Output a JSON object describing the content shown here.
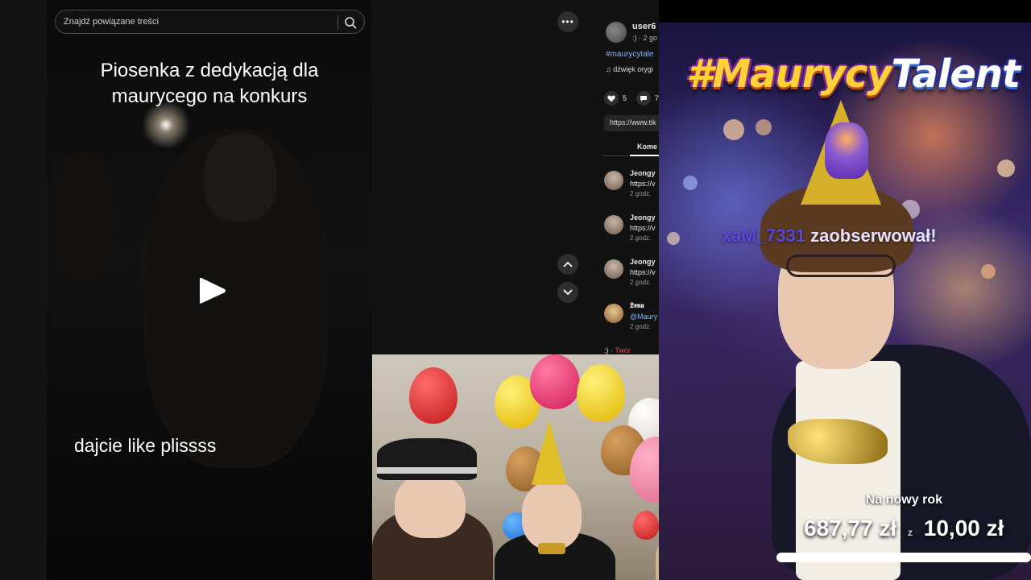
{
  "search": {
    "placeholder": "Znajdź powiązane treści"
  },
  "video": {
    "caption_top": "Piosenka z dedykacją dla maurycego na konkurs",
    "caption_bottom": "dajcie like plissss"
  },
  "more_button": {
    "label": "•••"
  },
  "info": {
    "username": "user6",
    "time": ":) · 2 go",
    "hashtag": "#maurycytale",
    "sound": "dźwięk orygi",
    "likes": "5",
    "comments_count": "7",
    "url": "https://www.tik",
    "tab": "Kome",
    "comments": [
      {
        "user": "Jeongy",
        "text": "https://v",
        "time": "2 godz."
      },
      {
        "user": "Jeongy",
        "text": "https://v",
        "time": "2 godz."
      },
      {
        "user": "Jeongy",
        "text": "https://v",
        "time": "2 godz."
      },
      {
        "user": "𝕷𝖊𝖓𝖆",
        "text": "@Maury",
        "time": "2 godz."
      }
    ],
    "last_row_prefix": ":) ·",
    "last_row_creator": "Twór"
  },
  "overlay": {
    "title_part1": "#Maurycy",
    "title_part2": "Talent",
    "follow_user": "xaM_7331",
    "follow_action": "zaobserwował!",
    "goal_label": "Na nowy rok",
    "goal_current": "687,77 zł",
    "goal_separator": "z",
    "goal_target": "10,00 zł",
    "goal_progress": 1.0
  },
  "colors": {
    "accent_link": "#7eb6ff",
    "creator_red": "#ff3b5c",
    "title_yellow": "#ffd23a",
    "follow_purple": "#5a46d8"
  }
}
